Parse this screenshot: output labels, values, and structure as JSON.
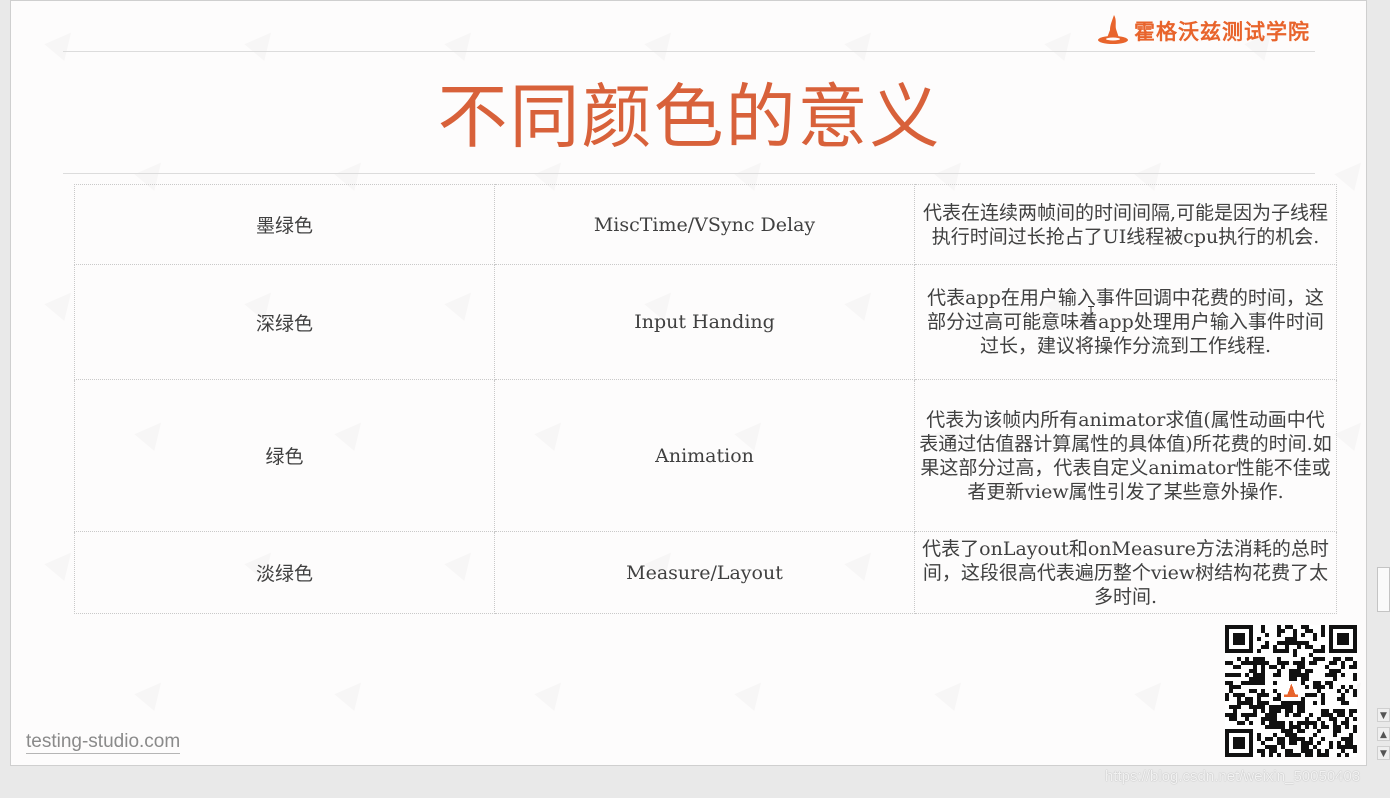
{
  "brand": {
    "name": "霍格沃兹测试学院",
    "icon": "witch-hat-icon",
    "color": "#e8642c"
  },
  "title": "不同颜色的意义",
  "table": {
    "rows": [
      {
        "color": "墨绿色",
        "name": "MiscTime/VSync Delay",
        "description": "代表在连续两帧间的时间间隔,可能是因为子线程执行时间过长抢占了UI线程被cpu执行的机会."
      },
      {
        "color": "深绿色",
        "name": "Input Handing",
        "description": "代表app在用户输入事件回调中花费的时间，这部分过高可能意味着app处理用户输入事件时间过长，建议将操作分流到工作线程."
      },
      {
        "color": "绿色",
        "name": "Animation",
        "description": "代表为该帧内所有animator求值(属性动画中代表通过估值器计算属性的具体值)所花费的时间.如果这部分过高，代表自定义animator性能不佳或者更新view属性引发了某些意外操作."
      },
      {
        "color": "淡绿色",
        "name": "Measure/Layout",
        "description": "代表了onLayout和onMeasure方法消耗的总时间，这段很高代表遍历整个view树结构花费了太多时间."
      }
    ]
  },
  "footer": {
    "site": "testing-studio.com",
    "qr_icon": "qr-code-icon"
  },
  "watermark_url": "https://blog.csdn.net/weixin_50050403",
  "scrollbar": {
    "up_icon": "arrow-up-icon",
    "down_icon": "arrow-down-icon"
  },
  "colors": {
    "title": "#d8613a",
    "text": "#404040",
    "background": "#fdfcfc"
  }
}
